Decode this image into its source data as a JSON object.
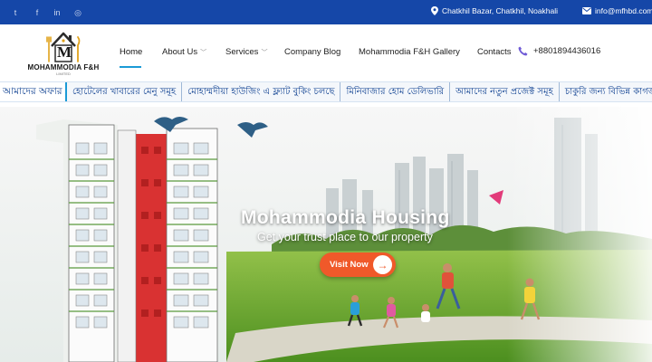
{
  "topbar": {
    "social": [
      {
        "icon": "twitter-icon",
        "glyph": "t"
      },
      {
        "icon": "facebook-icon",
        "glyph": "f"
      },
      {
        "icon": "linkedin-icon",
        "glyph": "in"
      },
      {
        "icon": "instagram-icon",
        "glyph": "◎"
      }
    ],
    "location": "Chatkhil Bazar, Chatkhil, Noakhali",
    "email": "info@mfhbd.com"
  },
  "logo": {
    "initial": "M",
    "brand": "MOHAMMODIA F&H",
    "tagline": "LIMITED"
  },
  "nav": {
    "home": "Home",
    "about": "About Us",
    "services": "Services",
    "blog": "Company Blog",
    "gallery": "Mohammodia F&H Gallery",
    "contacts": "Contacts",
    "phone": "+8801894436016"
  },
  "ticker": {
    "label": "আমাদের অফার",
    "items": [
      "হোটেলের খাবারের মেনু সমূহ",
      "মোহাম্মদীয়া হাউজিং এ ফ্ল্যাট বুকিং চলছে",
      "মিনিবাজার হোম ডেলিভারি",
      "আমাদের নতুন প্রজেক্ট সমূহ",
      "চাকুরি জন্য বিভিন্ন কাগজ পত্র"
    ]
  },
  "hero": {
    "title": "Mohammodia Housing",
    "subtitle": "Get your trust place to our property",
    "cta": "Visit Now",
    "cta_arrow": "→"
  },
  "colors": {
    "topbar": "#1547a8",
    "accent": "#1b9ad6",
    "cta": "#f0592a",
    "ticker_text": "#0a3d8f"
  }
}
